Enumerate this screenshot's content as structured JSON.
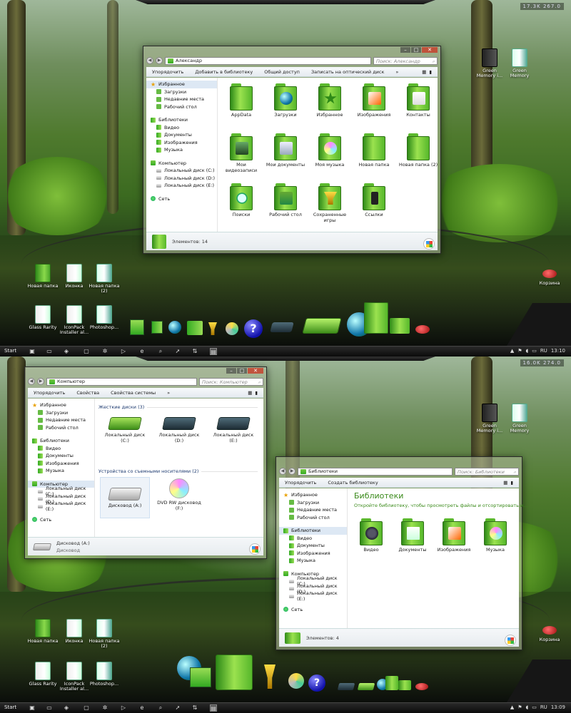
{
  "screens": [
    {
      "meter": "17.3K  267.0",
      "desktop_icons": [
        {
          "label": "Новая папка",
          "kind": "folder"
        },
        {
          "label": "Иконка",
          "kind": "doc"
        },
        {
          "label": "Новая папка (2)",
          "kind": "book"
        },
        {
          "label": "Glass Rarity",
          "kind": "doc"
        },
        {
          "label": "IconPack Installer al...",
          "kind": "doc"
        },
        {
          "label": "Photoshop...",
          "kind": "book"
        }
      ],
      "top_right_icons": [
        {
          "label": "Green Memory i...",
          "kind": "dark"
        },
        {
          "label": "Green Memory",
          "kind": "doc"
        }
      ],
      "recycle_label": "Корзина",
      "tray": {
        "lang": "RU",
        "time": "13:10"
      }
    },
    {
      "meter": "16.0K  274.0",
      "desktop_icons": [
        {
          "label": "Новая папка",
          "kind": "folder"
        },
        {
          "label": "Иконка",
          "kind": "doc"
        },
        {
          "label": "Новая папка (2)",
          "kind": "book"
        },
        {
          "label": "Glass Rarity",
          "kind": "doc"
        },
        {
          "label": "IconPack Installer al...",
          "kind": "doc"
        },
        {
          "label": "Photoshop...",
          "kind": "book"
        }
      ],
      "top_right_icons": [
        {
          "label": "Green Memory i...",
          "kind": "dark"
        },
        {
          "label": "Green Memory",
          "kind": "doc"
        }
      ],
      "recycle_label": "Корзина",
      "tray": {
        "lang": "RU",
        "time": "13:09"
      }
    }
  ],
  "taskbar": {
    "start_label": "Start"
  },
  "nav_pane": {
    "favorites": {
      "label": "Избранное",
      "items": [
        "Загрузки",
        "Недавние места",
        "Рабочий стол"
      ]
    },
    "libraries": {
      "label": "Библиотеки",
      "items": [
        "Видео",
        "Документы",
        "Изображения",
        "Музыка"
      ]
    },
    "computer": {
      "label": "Компьютер",
      "items": [
        "Локальный диск (C:)",
        "Локальный диск (D:)",
        "Локальный диск (E:)"
      ]
    },
    "network": {
      "label": "Сеть"
    }
  },
  "window_user": {
    "address": "Александр",
    "search_placeholder": "Поиск: Александр",
    "commands": [
      "Упорядочить",
      "Добавить в библиотеку",
      "Общий доступ",
      "Записать на оптический диск",
      "»"
    ],
    "items": [
      {
        "label": "AppData",
        "emblem": "none"
      },
      {
        "label": "Загрузки",
        "emblem": "globe"
      },
      {
        "label": "Избранное",
        "emblem": "star"
      },
      {
        "label": "Изображения",
        "emblem": "photo"
      },
      {
        "label": "Контакты",
        "emblem": "card"
      },
      {
        "label": "Мои видеозаписи",
        "emblem": "film"
      },
      {
        "label": "Мои документы",
        "emblem": "doc"
      },
      {
        "label": "Моя музыка",
        "emblem": "cd"
      },
      {
        "label": "Новая папка",
        "emblem": "none"
      },
      {
        "label": "Новая папка (2)",
        "emblem": "none"
      },
      {
        "label": "Поиски",
        "emblem": "search"
      },
      {
        "label": "Рабочий стол",
        "emblem": "desk"
      },
      {
        "label": "Сохраненные игры",
        "emblem": "trophy"
      },
      {
        "label": "Ссылки",
        "emblem": "phone"
      }
    ],
    "status": "Элементов: 14"
  },
  "window_computer": {
    "address": "Компьютер",
    "search_placeholder": "Поиск: Компьютер",
    "commands": [
      "Упорядочить",
      "Свойства",
      "Свойства системы",
      "»"
    ],
    "hard_disks_header": "Жесткие диски (3)",
    "hard_disks": [
      {
        "label": "Локальный диск (C:)",
        "style": "green"
      },
      {
        "label": "Локальный диск (D:)",
        "style": "dark"
      },
      {
        "label": "Локальный диск (E:)",
        "style": "dark"
      }
    ],
    "removable_header": "Устройства со съемными носителями (2)",
    "removable": [
      {
        "label": "Дисковод (A:)",
        "style": "silver"
      },
      {
        "label": "DVD RW дисковод (F:)",
        "style": "disc"
      }
    ],
    "status_title": "Дисковод (A:)",
    "status_sub": "Дисковод"
  },
  "window_libraries": {
    "address": "Библиотеки",
    "search_placeholder": "Поиск: Библиотеки",
    "commands": [
      "Упорядочить",
      "Создать библиотеку"
    ],
    "title": "Библиотеки",
    "subtitle": "Откройте библиотеку, чтобы просмотреть файлы и отсортировать и...",
    "items": [
      {
        "label": "Видео",
        "emblem": "film"
      },
      {
        "label": "Документы",
        "emblem": "doc"
      },
      {
        "label": "Изображения",
        "emblem": "photo"
      },
      {
        "label": "Музыка",
        "emblem": "cd"
      }
    ],
    "status": "Элементов: 4"
  },
  "colors": {
    "accent_green": "#3a8a1a",
    "folder_green": "#5cb92e",
    "taskbar": "#111111"
  }
}
